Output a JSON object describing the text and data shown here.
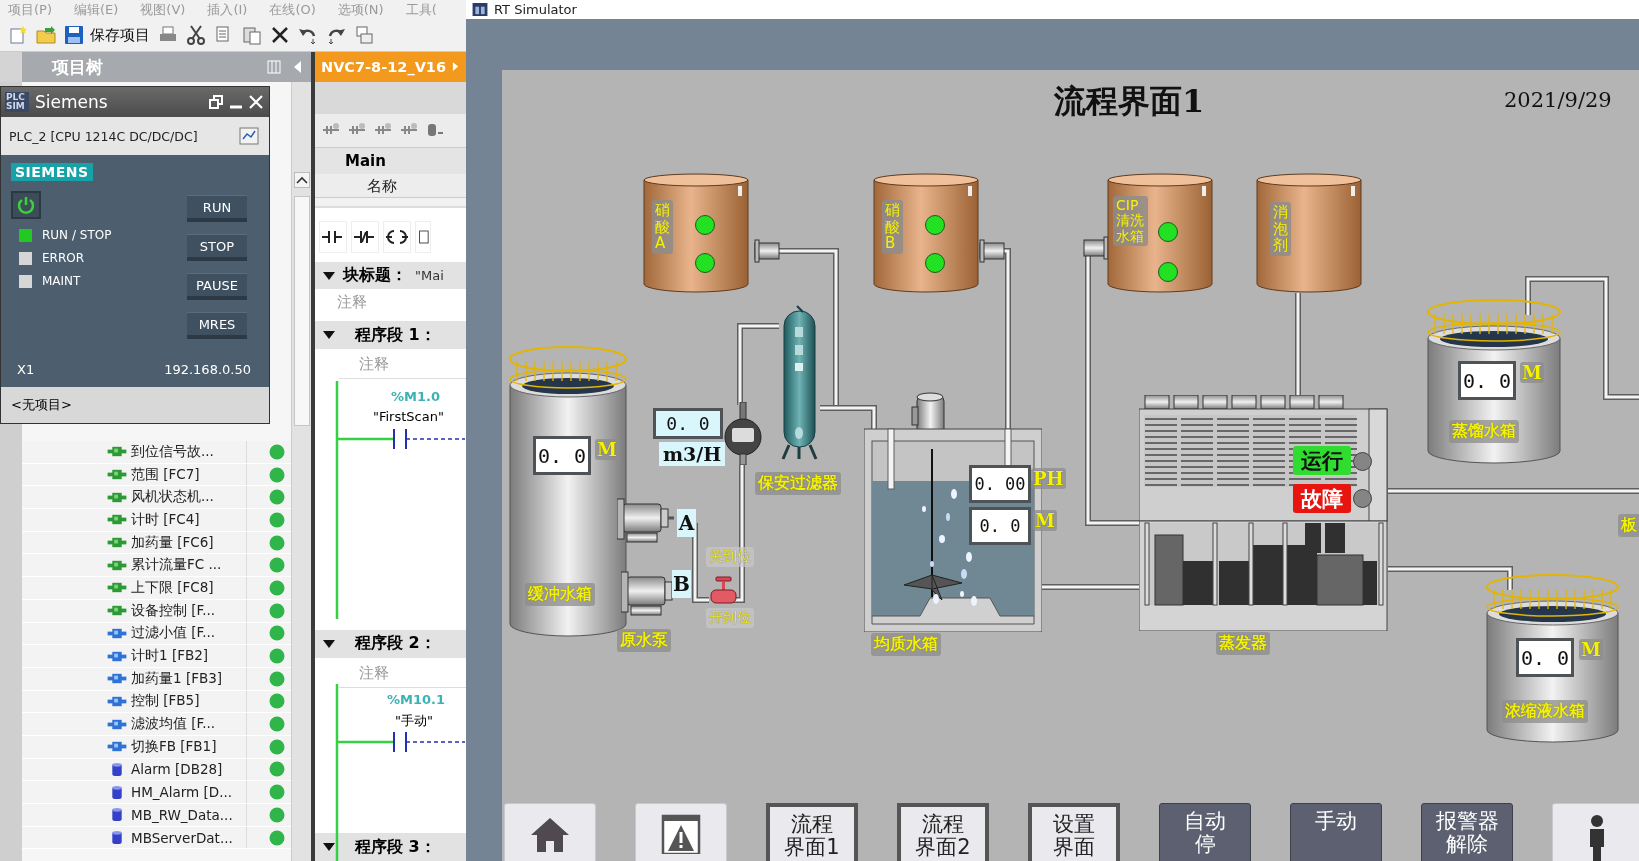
{
  "ide": {
    "menu": [
      "项目(P)",
      "编辑(E)",
      "视图(V)",
      "插入(I)",
      "在线(O)",
      "选项(N)",
      "工具("
    ],
    "save_button": "保存项目",
    "project_tree": {
      "title": "项目树",
      "items": [
        {
          "label": "到位信号故...",
          "kind": "fc"
        },
        {
          "label": "范围 [FC7]",
          "kind": "fc"
        },
        {
          "label": "风机状态机...",
          "kind": "fc"
        },
        {
          "label": "计时 [FC4]",
          "kind": "fc"
        },
        {
          "label": "加药量 [FC6]",
          "kind": "fc"
        },
        {
          "label": "累计流量FC ...",
          "kind": "fc"
        },
        {
          "label": "上下限 [FC8]",
          "kind": "fc"
        },
        {
          "label": "设备控制 [F...",
          "kind": "fc"
        },
        {
          "label": "过滤小值 [F...",
          "kind": "fb"
        },
        {
          "label": "计时1 [FB2]",
          "kind": "fb"
        },
        {
          "label": "加药量1 [FB3]",
          "kind": "fb"
        },
        {
          "label": "控制 [FB5]",
          "kind": "fb"
        },
        {
          "label": "滤波均值 [F...",
          "kind": "fb"
        },
        {
          "label": "切换FB [FB1]",
          "kind": "fb"
        },
        {
          "label": "Alarm [DB28]",
          "kind": "db"
        },
        {
          "label": "HM_Alarm [D...",
          "kind": "db"
        },
        {
          "label": "MB_RW_Data...",
          "kind": "db"
        },
        {
          "label": "MBServerDat...",
          "kind": "db"
        }
      ]
    },
    "editor": {
      "tab": "NVC7-8-12_V16",
      "block": "Main",
      "column": "名称",
      "block_title": {
        "label": "块标题：",
        "value": "\"Mai"
      },
      "block_comment": "注释",
      "networks": [
        {
          "title": "程序段 1：",
          "comment": "注释",
          "operand": "%M1.0",
          "symbol": "\"FirstScan\""
        },
        {
          "title": "程序段 2：",
          "comment": "注释",
          "operand": "%M10.1",
          "symbol": "\"手动\""
        },
        {
          "title": "程序段 3："
        }
      ]
    }
  },
  "plcsim": {
    "badge": "PLC SIM",
    "title": "Siemens",
    "device": "PLC_2 [CPU 1214C DC/DC/DC]",
    "brand": "SIEMENS",
    "leds": [
      {
        "label": "RUN / STOP",
        "on": true
      },
      {
        "label": "ERROR",
        "on": false
      },
      {
        "label": "MAINT",
        "on": false
      }
    ],
    "buttons": [
      "RUN",
      "STOP",
      "PAUSE",
      "MRES"
    ],
    "interface": "X1",
    "address": "192.168.0.50",
    "project": "<无项目>"
  },
  "simulator": {
    "title": "RT Simulator",
    "screen": {
      "title": "流程界面1",
      "date": "2021/9/29",
      "feed_tanks": [
        {
          "label": "硝酸A",
          "indicators": [
            {
              "on": true
            },
            {
              "on": true
            }
          ]
        },
        {
          "label": "硝酸B",
          "indicators": [
            {
              "on": true
            },
            {
              "on": true
            }
          ]
        },
        {
          "label": "CIP清洗水箱",
          "indicators": [
            {
              "on": true
            },
            {
              "on": true
            }
          ]
        },
        {
          "label": "消泡剂"
        }
      ],
      "storage_tanks": [
        {
          "value": "0. 0",
          "unit": "M",
          "label": "缓冲水箱"
        },
        {
          "value": "0. 0",
          "unit": "M",
          "label": "蒸馏水箱"
        },
        {
          "value": "0. 0",
          "unit": "M",
          "label": "浓缩液水箱"
        }
      ],
      "flow_meter": {
        "value": "0. 0",
        "unit": "m3/H"
      },
      "filter_label": "保安过滤器",
      "pumps": [
        {
          "label": "A"
        },
        {
          "label": "B"
        }
      ],
      "pump_label": "原水泵",
      "valve": {
        "closed_label": "关到位",
        "open_label": "开到位"
      },
      "mixing_tank": {
        "label": "均质水箱",
        "readings": [
          {
            "value": "0. 00",
            "unit": "PH"
          },
          {
            "value": "0. 0",
            "unit": "M"
          }
        ]
      },
      "evaporator": {
        "label": "蒸发器",
        "lamps": [
          {
            "label": "运行",
            "kind": "run",
            "on": false
          },
          {
            "label": "故障",
            "kind": "fault",
            "on": false
          }
        ]
      },
      "edge_label": "板"
    },
    "nav_buttons": [
      {
        "kind": "home"
      },
      {
        "kind": "alarm"
      },
      {
        "kind": "screen",
        "lines": [
          "流程",
          "界面1"
        ]
      },
      {
        "kind": "screen",
        "lines": [
          "流程",
          "界面2"
        ]
      },
      {
        "kind": "screen",
        "lines": [
          "设置",
          "界面"
        ]
      },
      {
        "kind": "command",
        "lines": [
          "自动",
          "停"
        ]
      },
      {
        "kind": "command",
        "lines": [
          "手动"
        ]
      },
      {
        "kind": "command",
        "lines": [
          "报警器",
          "解除"
        ]
      },
      {
        "kind": "user"
      }
    ]
  }
}
